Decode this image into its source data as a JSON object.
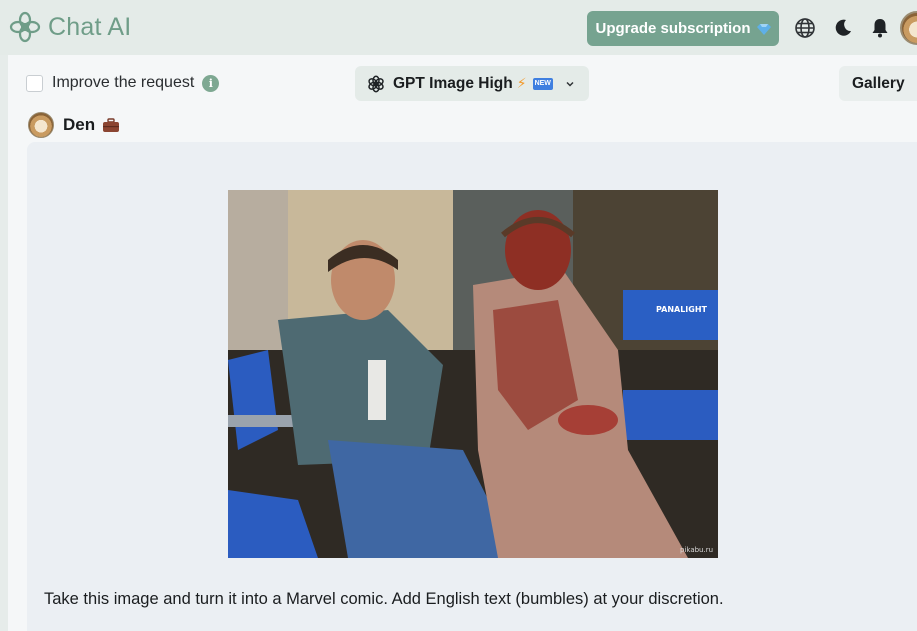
{
  "app": {
    "title": "Chat AI"
  },
  "header": {
    "upgrade_label": "Upgrade subscription",
    "upgrade_icon": "gem-icon",
    "icons": [
      "globe-icon",
      "moon-icon",
      "bell-icon"
    ],
    "accent_color": "#76a390"
  },
  "toolbar": {
    "improve_label": "Improve the request",
    "improve_checked": false,
    "model_name": "GPT Image High",
    "model_badge": "NEW",
    "gallery_label": "Gallery"
  },
  "message": {
    "author": "Den",
    "author_icon": "briefcase-icon",
    "text": "Take this image and turn it into a Marvel comic. Add English text (bumbles) at your discretion.",
    "image_caption": "PANALIGHT",
    "image_watermark": "pikabu.ru"
  }
}
